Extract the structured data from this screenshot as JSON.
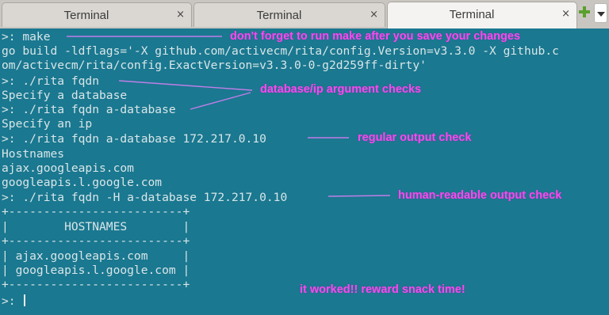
{
  "tabs": [
    {
      "label": "Terminal",
      "close": "×"
    },
    {
      "label": "Terminal",
      "close": "×"
    },
    {
      "label": "Terminal",
      "close": "×"
    }
  ],
  "active_tab": 2,
  "terminal": {
    "lines": [
      ">: make",
      "go build -ldflags='-X github.com/activecm/rita/config.Version=v3.3.0 -X github.c",
      "om/activecm/rita/config.ExactVersion=v3.3.0-0-g2d259ff-dirty'",
      ">: ./rita fqdn",
      "Specify a database",
      ">: ./rita fqdn a-database",
      "Specify an ip",
      ">: ./rita fqdn a-database 172.217.0.10",
      "Hostnames",
      "ajax.googleapis.com",
      "googleapis.l.google.com",
      ">: ./rita fqdn -H a-database 172.217.0.10",
      "+-------------------------+",
      "|        HOSTNAMES        |",
      "+-------------------------+",
      "| ajax.googleapis.com     |",
      "| googleapis.l.google.com |",
      "+-------------------------+",
      "",
      ">: "
    ]
  },
  "annotations": [
    {
      "text": "don't forget to run make after you save your changes"
    },
    {
      "text": "database/ip argument checks"
    },
    {
      "text": "regular output check"
    },
    {
      "text": "human-readable output check"
    },
    {
      "text": "it worked!! reward snack time!"
    }
  ],
  "colors": {
    "terminal_bg": "#1a7890",
    "terminal_text": "#d9e6e8",
    "annotation": "#f44cf0",
    "new_tab_icon": "#5aa02c"
  },
  "icons": {
    "new_tab": "plus-icon",
    "menu": "chevron-down-icon"
  }
}
